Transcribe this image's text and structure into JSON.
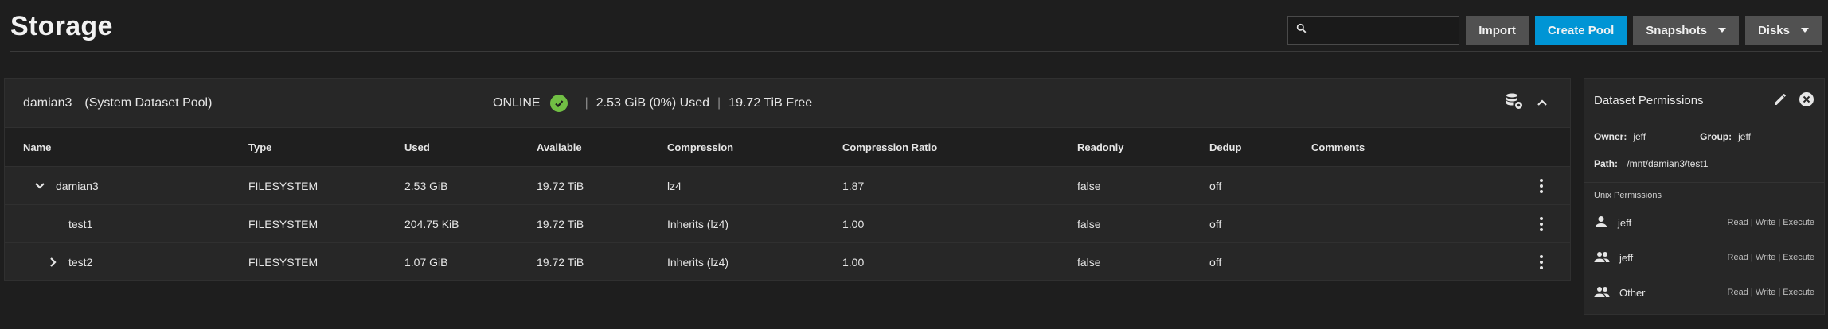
{
  "page": {
    "title": "Storage"
  },
  "toolbar": {
    "search_placeholder": "",
    "import_label": "Import",
    "create_pool_label": "Create Pool",
    "snapshots_label": "Snapshots",
    "disks_label": "Disks"
  },
  "pool": {
    "name": "damian3",
    "system_label": "(System Dataset Pool)",
    "status": "ONLINE",
    "used": "2.53 GiB (0%) Used",
    "free": "19.72 TiB Free"
  },
  "table": {
    "headers": {
      "name": "Name",
      "type": "Type",
      "used": "Used",
      "available": "Available",
      "compression": "Compression",
      "ratio": "Compression Ratio",
      "readonly": "Readonly",
      "dedup": "Dedup",
      "comments": "Comments"
    },
    "rows": [
      {
        "name": "damian3",
        "type": "FILESYSTEM",
        "used": "2.53 GiB",
        "available": "19.72 TiB",
        "compression": "lz4",
        "ratio": "1.87",
        "readonly": "false",
        "dedup": "off",
        "comments": ""
      },
      {
        "name": "test1",
        "type": "FILESYSTEM",
        "used": "204.75 KiB",
        "available": "19.72 TiB",
        "compression": "Inherits (lz4)",
        "ratio": "1.00",
        "readonly": "false",
        "dedup": "off",
        "comments": ""
      },
      {
        "name": "test2",
        "type": "FILESYSTEM",
        "used": "1.07 GiB",
        "available": "19.72 TiB",
        "compression": "Inherits (lz4)",
        "ratio": "1.00",
        "readonly": "false",
        "dedup": "off",
        "comments": ""
      }
    ]
  },
  "permissions": {
    "title": "Dataset Permissions",
    "owner_label": "Owner:",
    "owner": "jeff",
    "group_label": "Group:",
    "group": "jeff",
    "path_label": "Path:",
    "path": "/mnt/damian3/test1",
    "unix_label": "Unix Permissions",
    "entries": [
      {
        "who": "jeff",
        "rights": "Read | Write | Execute",
        "icon": "user-icon"
      },
      {
        "who": "jeff",
        "rights": "Read | Write | Execute",
        "icon": "group-icon"
      },
      {
        "who": "Other",
        "rights": "Read | Write | Execute",
        "icon": "group-icon"
      }
    ]
  },
  "colors": {
    "accent": "#0095d5",
    "online": "#71bf44",
    "background": "#1e1e1e",
    "panel": "#272727"
  }
}
